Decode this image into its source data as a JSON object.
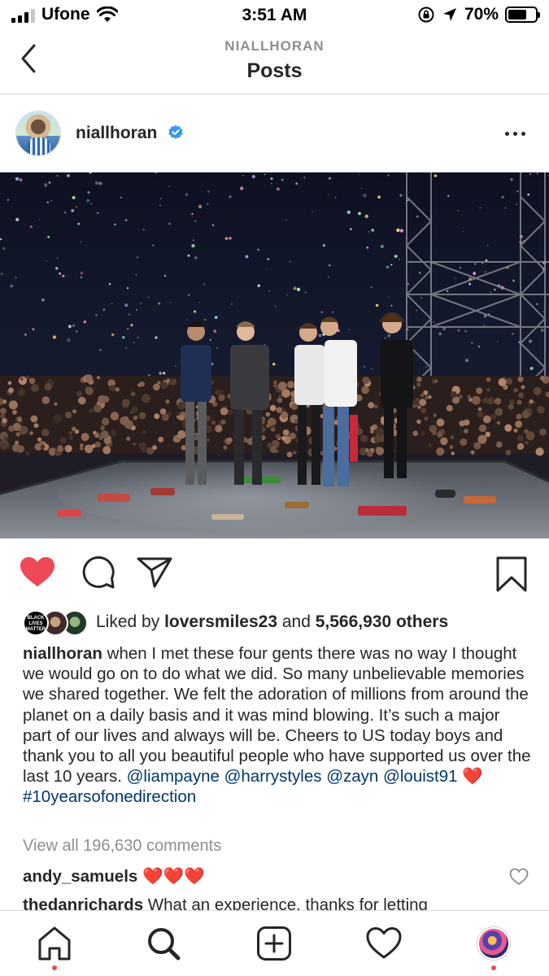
{
  "status_bar": {
    "carrier": "Ufone",
    "time": "3:51 AM",
    "battery": "70%",
    "battery_level": 0.7
  },
  "header": {
    "subtitle": "NIALLHORAN",
    "title": "Posts"
  },
  "post": {
    "username": "niallhoran",
    "verified": true,
    "image_alt": "",
    "liked": true,
    "likes": {
      "prefix": "Liked by ",
      "user": "loversmiles23",
      "middle": " and ",
      "count": "5,566,930 others",
      "first_avatar_text": "BLACK LIVES MATTER"
    },
    "caption": {
      "user": "niallhoran",
      "text": " when I met these four gents there was no way I thought we would go on to do what we did. So many unbelievable memories we shared together. We felt the adoration of millions from around the planet on a daily basis and it was mind blowing. It’s such a major part of our lives and always will be. Cheers to US today boys and thank you to all you beautiful people who have supported us over the last 10 years. ",
      "mentions": [
        "@liampayne",
        "@harrystyles",
        "@zayn",
        "@louist91"
      ],
      "heart": "❤️",
      "hashtag": "#10yearsofonedirection"
    },
    "view_all_comments": "View all 196,630 comments",
    "comments": [
      {
        "user": "andy_samuels",
        "text": " ❤️❤️❤️"
      },
      {
        "user": "thedanrichards",
        "text": " What an experience, thanks for letting"
      }
    ]
  },
  "tabbar": {
    "items": [
      "home-icon",
      "search-icon",
      "new-post-icon",
      "activity-icon",
      "profile-avatar"
    ]
  },
  "colors": {
    "like_red": "#ed4956",
    "mention_blue": "#00376b",
    "verified_blue": "#3897f0",
    "muted_gray": "#8e8e8e"
  }
}
